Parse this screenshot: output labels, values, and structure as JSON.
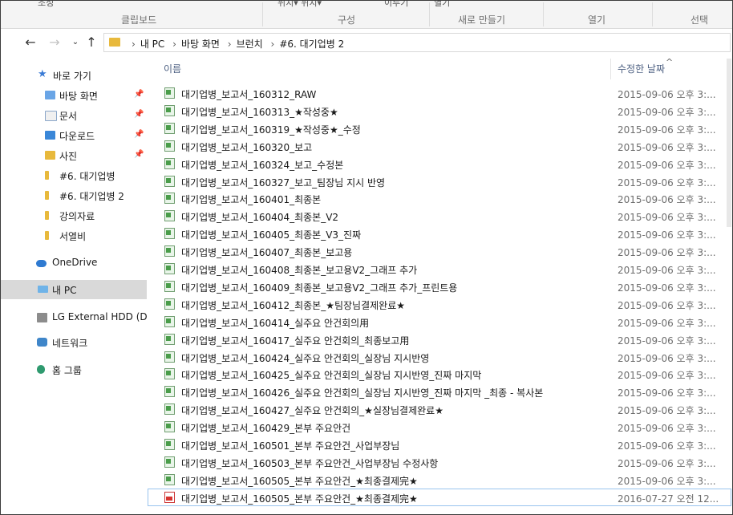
{
  "ribbon": {
    "top_fragments": [
      "조성",
      "위치▾  위치▾",
      "이루기",
      "열기"
    ],
    "groups": [
      "클립보드",
      "구성",
      "새로 만들기",
      "열기",
      "선택"
    ]
  },
  "address": {
    "crumbs": [
      "내 PC",
      "바탕 화면",
      "브런치",
      "#6. 대기업병 2"
    ]
  },
  "nav": {
    "items": [
      {
        "label": "바로 가기",
        "icon": "star-icon",
        "pinned": false
      },
      {
        "label": "바탕 화면",
        "icon": "desktop-folder-icon",
        "pinned": true
      },
      {
        "label": "문서",
        "icon": "documents-icon",
        "pinned": true
      },
      {
        "label": "다운로드",
        "icon": "download-icon",
        "pinned": true
      },
      {
        "label": "사진",
        "icon": "pictures-icon",
        "pinned": true
      },
      {
        "label": "#6. 대기업병",
        "icon": "folder-icon",
        "pinned": false
      },
      {
        "label": "#6. 대기업병 2",
        "icon": "folder-icon",
        "pinned": false
      },
      {
        "label": "강의자료",
        "icon": "folder-icon",
        "pinned": false
      },
      {
        "label": "서열비",
        "icon": "folder-icon",
        "pinned": false
      },
      {
        "label": "OneDrive",
        "icon": "cloud-icon",
        "pinned": false
      },
      {
        "label": "내 PC",
        "icon": "computer-icon",
        "pinned": false
      },
      {
        "label": "LG External HDD (D:",
        "icon": "drive-icon",
        "pinned": false
      },
      {
        "label": "네트워크",
        "icon": "network-icon",
        "pinned": false
      },
      {
        "label": "홈 그룹",
        "icon": "homegroup-icon",
        "pinned": false
      }
    ],
    "pin_glyph": "📌"
  },
  "list": {
    "col_name": "이름",
    "col_date": "수정한 날짜",
    "files": [
      {
        "name": "대기업병_보고서_160312_RAW",
        "date": "2015-09-06 오후 3:...",
        "type": "xlsx"
      },
      {
        "name": "대기업병_보고서_160313_★작성중★",
        "date": "2015-09-06 오후 3:...",
        "type": "xlsx"
      },
      {
        "name": "대기업병_보고서_160319_★작성중★_수정",
        "date": "2015-09-06 오후 3:...",
        "type": "xlsx"
      },
      {
        "name": "대기업병_보고서_160320_보고",
        "date": "2015-09-06 오후 3:...",
        "type": "xlsx"
      },
      {
        "name": "대기업병_보고서_160324_보고_수정본",
        "date": "2015-09-06 오후 3:...",
        "type": "xlsx"
      },
      {
        "name": "대기업병_보고서_160327_보고_팀장님 지시 반영",
        "date": "2015-09-06 오후 3:...",
        "type": "xlsx"
      },
      {
        "name": "대기업병_보고서_160401_최종본",
        "date": "2015-09-06 오후 3:...",
        "type": "xlsx"
      },
      {
        "name": "대기업병_보고서_160404_최종본_V2",
        "date": "2015-09-06 오후 3:...",
        "type": "xlsx"
      },
      {
        "name": "대기업병_보고서_160405_최종본_V3_진짜",
        "date": "2015-09-06 오후 3:...",
        "type": "xlsx"
      },
      {
        "name": "대기업병_보고서_160407_최종본_보고용",
        "date": "2015-09-06 오후 3:...",
        "type": "xlsx"
      },
      {
        "name": "대기업병_보고서_160408_최종본_보고용V2_그래프 추가",
        "date": "2015-09-06 오후 3:...",
        "type": "xlsx"
      },
      {
        "name": "대기업병_보고서_160409_최종본_보고용V2_그래프 추가_프린트용",
        "date": "2015-09-06 오후 3:...",
        "type": "xlsx"
      },
      {
        "name": "대기업병_보고서_160412_최종본_★팀장님결제완료★",
        "date": "2015-09-06 오후 3:...",
        "type": "xlsx"
      },
      {
        "name": "대기업병_보고서_160414_실주요 안건회의用",
        "date": "2015-09-06 오후 3:...",
        "type": "xlsx"
      },
      {
        "name": "대기업병_보고서_160417_실주요 안건회의_최종보고用",
        "date": "2015-09-06 오후 3:...",
        "type": "xlsx"
      },
      {
        "name": "대기업병_보고서_160424_실주요 안건회의_실장님 지시반영",
        "date": "2015-09-06 오후 3:...",
        "type": "xlsx"
      },
      {
        "name": "대기업병_보고서_160425_실주요 안건회의_실장님 지시반영_진짜 마지막",
        "date": "2015-09-06 오후 3:...",
        "type": "xlsx"
      },
      {
        "name": "대기업병_보고서_160426_실주요 안건회의_실장님 지시반영_진짜 마지막 _최종 - 복사본",
        "date": "2015-09-06 오후 3:...",
        "type": "xlsx"
      },
      {
        "name": "대기업병_보고서_160427_실주요 안건회의_★실장님결제완료★",
        "date": "2015-09-06 오후 3:...",
        "type": "xlsx"
      },
      {
        "name": "대기업병_보고서_160429_본부 주요안건",
        "date": "2015-09-06 오후 3:...",
        "type": "xlsx"
      },
      {
        "name": "대기업병_보고서_160501_본부 주요안건_사업부장님",
        "date": "2015-09-06 오후 3:...",
        "type": "xlsx"
      },
      {
        "name": "대기업병_보고서_160503_본부 주요안건_사업부장님 수정사항",
        "date": "2015-09-06 오후 3:...",
        "type": "xlsx"
      },
      {
        "name": "대기업병_보고서_160505_본부 주요안건_★최종결제完★",
        "date": "2015-09-06 오후 3:...",
        "type": "xlsx"
      },
      {
        "name": "대기업병_보고서_160505_본부 주요안건_★최종결제完★",
        "date": "2016-07-27 오전 12...",
        "type": "pdf"
      }
    ]
  },
  "colors": {
    "folder": "#e8b93c",
    "selected_nav": "#d9d9d9",
    "header_text": "#4d6082"
  }
}
